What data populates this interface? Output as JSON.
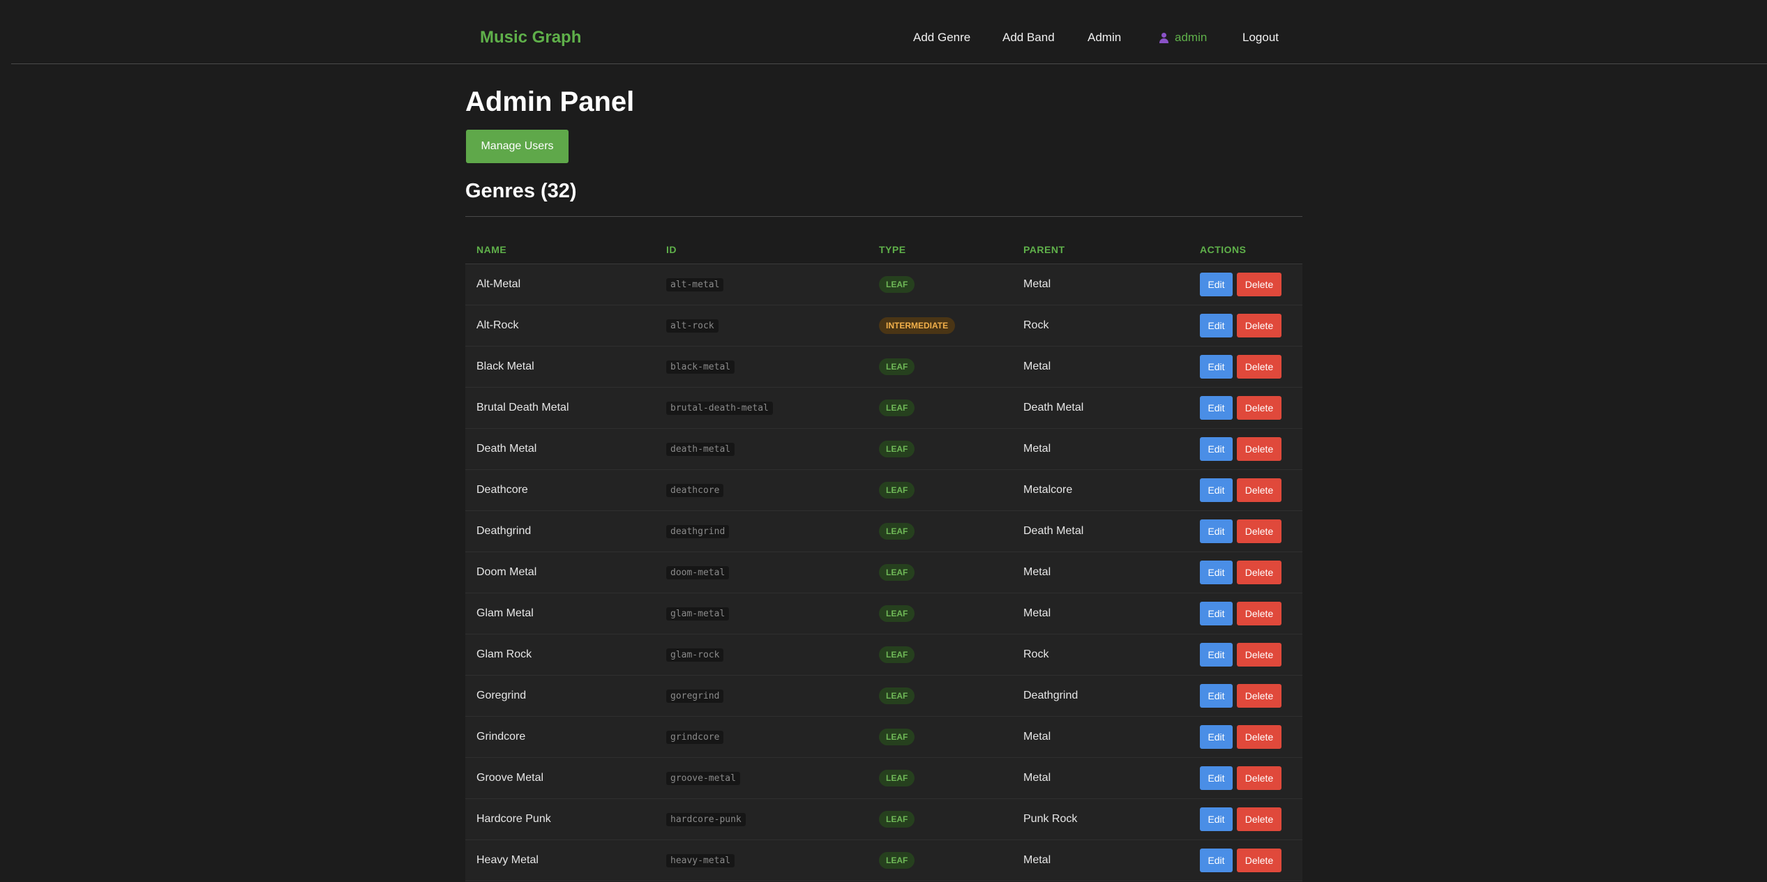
{
  "header": {
    "brand": "Music Graph",
    "nav": {
      "add_genre": "Add Genre",
      "add_band": "Add Band",
      "admin": "Admin",
      "user": "admin",
      "logout": "Logout"
    }
  },
  "page": {
    "title": "Admin Panel",
    "manage_users_label": "Manage Users",
    "genres_heading": "Genres (32)"
  },
  "table": {
    "columns": [
      "NAME",
      "ID",
      "TYPE",
      "PARENT",
      "ACTIONS"
    ],
    "edit_label": "Edit",
    "delete_label": "Delete",
    "rows": [
      {
        "name": "Alt-Metal",
        "id": "alt-metal",
        "type": "LEAF",
        "parent": "Metal"
      },
      {
        "name": "Alt-Rock",
        "id": "alt-rock",
        "type": "INTERMEDIATE",
        "parent": "Rock"
      },
      {
        "name": "Black Metal",
        "id": "black-metal",
        "type": "LEAF",
        "parent": "Metal"
      },
      {
        "name": "Brutal Death Metal",
        "id": "brutal-death-metal",
        "type": "LEAF",
        "parent": "Death Metal"
      },
      {
        "name": "Death Metal",
        "id": "death-metal",
        "type": "LEAF",
        "parent": "Metal"
      },
      {
        "name": "Deathcore",
        "id": "deathcore",
        "type": "LEAF",
        "parent": "Metalcore"
      },
      {
        "name": "Deathgrind",
        "id": "deathgrind",
        "type": "LEAF",
        "parent": "Death Metal"
      },
      {
        "name": "Doom Metal",
        "id": "doom-metal",
        "type": "LEAF",
        "parent": "Metal"
      },
      {
        "name": "Glam Metal",
        "id": "glam-metal",
        "type": "LEAF",
        "parent": "Metal"
      },
      {
        "name": "Glam Rock",
        "id": "glam-rock",
        "type": "LEAF",
        "parent": "Rock"
      },
      {
        "name": "Goregrind",
        "id": "goregrind",
        "type": "LEAF",
        "parent": "Deathgrind"
      },
      {
        "name": "Grindcore",
        "id": "grindcore",
        "type": "LEAF",
        "parent": "Metal"
      },
      {
        "name": "Groove Metal",
        "id": "groove-metal",
        "type": "LEAF",
        "parent": "Metal"
      },
      {
        "name": "Hardcore Punk",
        "id": "hardcore-punk",
        "type": "LEAF",
        "parent": "Punk Rock"
      },
      {
        "name": "Heavy Metal",
        "id": "heavy-metal",
        "type": "LEAF",
        "parent": "Metal"
      }
    ]
  }
}
